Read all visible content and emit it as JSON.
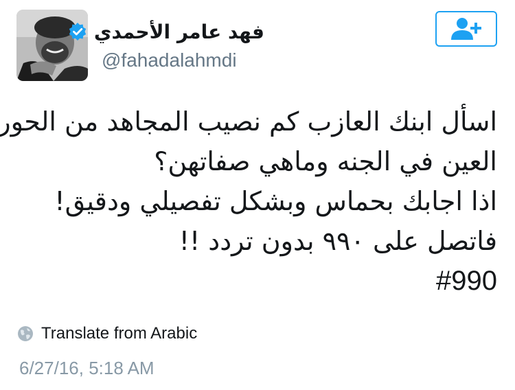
{
  "user": {
    "display_name": "فهد عامر الأحمدي",
    "username": "@fahadalahmdi",
    "verified": true
  },
  "tweet": {
    "lines": [
      "اسأل ابنك العازب كم نصيب المجاهد من الحور",
      "العين في الجنه وماهي صفاتهن؟",
      "اذا اجابك بحماس وبشكل تفصيلي ودقيق!",
      "فاتصل على ٩٩٠ بدون تردد !!"
    ],
    "hashtag": "#990"
  },
  "translate": {
    "label": "Translate from Arabic",
    "icon": "globe-icon"
  },
  "timestamp": "6/27/16, 5:18 AM",
  "colors": {
    "accent": "#1da1f2",
    "text": "#14171a",
    "muted": "#657786",
    "timestamp": "#8899a6"
  },
  "icons": {
    "verified": "verified-badge-icon",
    "follow": "follow-user-icon"
  }
}
